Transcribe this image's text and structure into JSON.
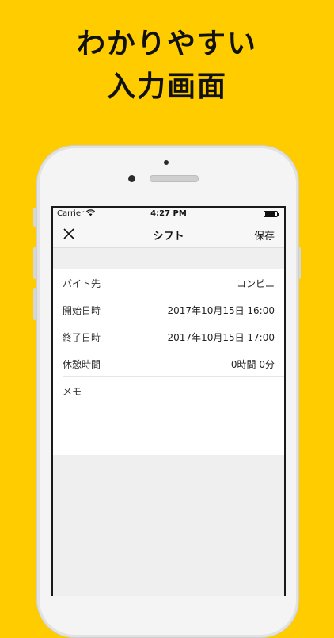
{
  "headline": {
    "line1": "わかりやすい",
    "line2": "入力画面"
  },
  "statusbar": {
    "carrier": "Carrier",
    "wifi_icon": "wifi-icon",
    "time": "4:27 PM",
    "battery_icon": "battery-icon"
  },
  "navbar": {
    "close_icon": "close-icon",
    "title": "シフト",
    "save_label": "保存"
  },
  "form": {
    "rows": [
      {
        "label": "バイト先",
        "value": "コンビニ"
      },
      {
        "label": "開始日時",
        "value": "2017年10月15日  16:00"
      },
      {
        "label": "終了日時",
        "value": "2017年10月15日  17:00"
      },
      {
        "label": "休憩時間",
        "value": "0時間 0分"
      }
    ],
    "memo_label": "メモ",
    "memo_value": ""
  },
  "colors": {
    "background": "#FFCC00",
    "text": "#111111"
  }
}
